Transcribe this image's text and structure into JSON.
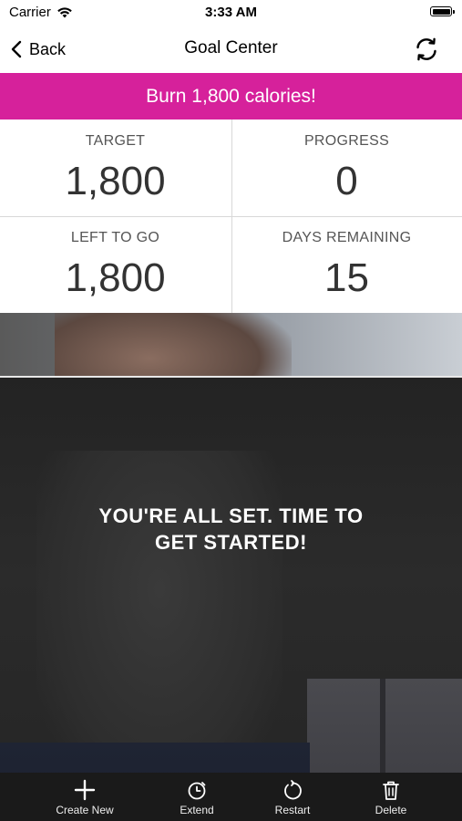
{
  "status_bar": {
    "carrier": "Carrier",
    "time": "3:33 AM"
  },
  "nav": {
    "back_label": "Back",
    "title": "Goal Center"
  },
  "banner": {
    "text": "Burn 1,800 calories!",
    "color": "#d6219b"
  },
  "stats": {
    "target": {
      "label": "TARGET",
      "value": "1,800"
    },
    "progress": {
      "label": "PROGRESS",
      "value": "0"
    },
    "left_to_go": {
      "label": "LEFT TO GO",
      "value": "1,800"
    },
    "days_remaining": {
      "label": "DAYS REMAINING",
      "value": "15"
    }
  },
  "hero": {
    "message_line1": "YOU'RE ALL SET. TIME TO",
    "message_line2": "GET STARTED!"
  },
  "toolbar": {
    "create_new": {
      "label": "Create New",
      "icon": "plus-icon"
    },
    "extend": {
      "label": "Extend",
      "icon": "timer-icon"
    },
    "restart": {
      "label": "Restart",
      "icon": "restart-icon"
    },
    "delete": {
      "label": "Delete",
      "icon": "trash-icon"
    }
  }
}
